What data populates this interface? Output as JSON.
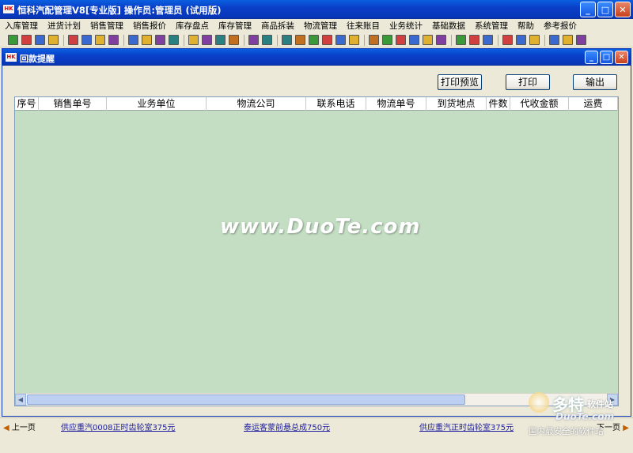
{
  "app": {
    "title": "恒科汽配管理V8[专业版] 操作员:管理员 (试用版)",
    "icon_text": "HK"
  },
  "menu": [
    "入库管理",
    "进货计划",
    "销售管理",
    "销售报价",
    "库存盘点",
    "库存管理",
    "商品拆装",
    "物流管理",
    "往来账目",
    "业务统计",
    "基础数据",
    "系统管理",
    "帮助",
    "参考报价"
  ],
  "toolbar": {
    "groups": [
      [
        "import-icon",
        "export-icon",
        "chart-icon",
        "mail-icon"
      ],
      [
        "window-icon",
        "edit-icon",
        "image-icon",
        "doc-icon"
      ],
      [
        "folder-open-icon",
        "folder-icon",
        "picture-icon",
        "photo-icon"
      ],
      [
        "download-icon",
        "inbox-icon",
        "inbox-out-icon",
        "inbox-check-icon"
      ],
      [
        "home-icon",
        "house-up-icon"
      ],
      [
        "grid-red-icon",
        "sheet-icon",
        "report-icon",
        "cube-icon",
        "cube2-icon",
        "cube3-icon"
      ],
      [
        "bar-chart-icon",
        "line-chart-icon",
        "column-chart-icon",
        "tray-icon",
        "tray2-icon",
        "tray3-icon"
      ],
      [
        "people-icon",
        "house-icon",
        "card-icon"
      ],
      [
        "key-icon",
        "printer-icon",
        "calculator-icon"
      ],
      [
        "exit-icon",
        "book-icon",
        "help-book-icon"
      ]
    ]
  },
  "window": {
    "title": "回款提醒",
    "icon_text": "HK",
    "buttons": {
      "preview": "打印预览",
      "print": "打印",
      "export": "输出"
    }
  },
  "grid": {
    "columns": [
      "序号",
      "销售单号",
      "业务单位",
      "物流公司",
      "联系电话",
      "物流单号",
      "到货地点",
      "件数",
      "代收金额",
      "运费"
    ],
    "rows": []
  },
  "watermark": "www.DuoTe.com",
  "status": {
    "prev": "上一页",
    "next": "下一页",
    "messages": [
      "供应重汽0008正时齿轮室375元",
      "泰运客蒙前悬总成750元",
      "供应重汽正时齿轮室375元"
    ]
  },
  "logo": {
    "name": "多特",
    "suffix": "软件站",
    "site": "DuoTe.com",
    "slogan": "国内最安全的软件站"
  },
  "colors": {
    "titlebar": "#0a3fc8",
    "grid_background": "#c4dec4",
    "chrome": "#ece9d8"
  }
}
